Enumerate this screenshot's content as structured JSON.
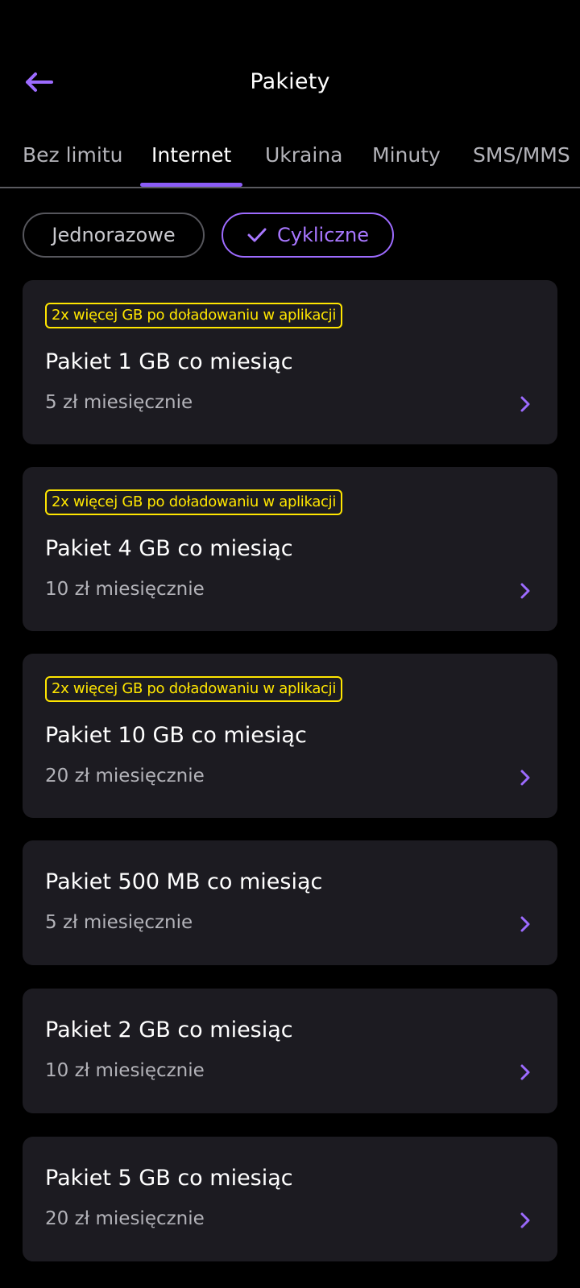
{
  "header": {
    "title": "Pakiety",
    "back_icon": "arrow-left-icon"
  },
  "tabs": [
    {
      "label": "Bez limitu",
      "active": false
    },
    {
      "label": "Internet",
      "active": true
    },
    {
      "label": "Ukraina",
      "active": false
    },
    {
      "label": "Minuty",
      "active": false
    },
    {
      "label": "SMS/MMS",
      "active": false
    }
  ],
  "filters": {
    "one_time": {
      "label": "Jednorazowe",
      "selected": false
    },
    "cyclic": {
      "label": "Cykliczne",
      "selected": true,
      "icon": "check-icon"
    }
  },
  "packages": [
    {
      "promo": "2x więcej GB po doładowaniu w aplikacji",
      "title": "Pakiet 1 GB co miesiąc",
      "price": "5 zł miesięcznie"
    },
    {
      "promo": "2x więcej GB po doładowaniu w aplikacji",
      "title": "Pakiet 4 GB co miesiąc",
      "price": "10 zł miesięcznie"
    },
    {
      "promo": "2x więcej GB po doładowaniu w aplikacji",
      "title": "Pakiet 10 GB co miesiąc",
      "price": "20 zł miesięcznie"
    },
    {
      "title": "Pakiet 500 MB co miesiąc",
      "price": "5 zł miesięcznie"
    },
    {
      "title": "Pakiet 2 GB co miesiąc",
      "price": "10 zł miesięcznie"
    },
    {
      "title": "Pakiet 5 GB co miesiąc",
      "price": "20 zł miesięcznie"
    }
  ],
  "colors": {
    "background": "#000000",
    "card": "#1c1b21",
    "accent": "#8b5cf6",
    "promo": "#ffe600",
    "muted_text": "#b3b3b9"
  }
}
